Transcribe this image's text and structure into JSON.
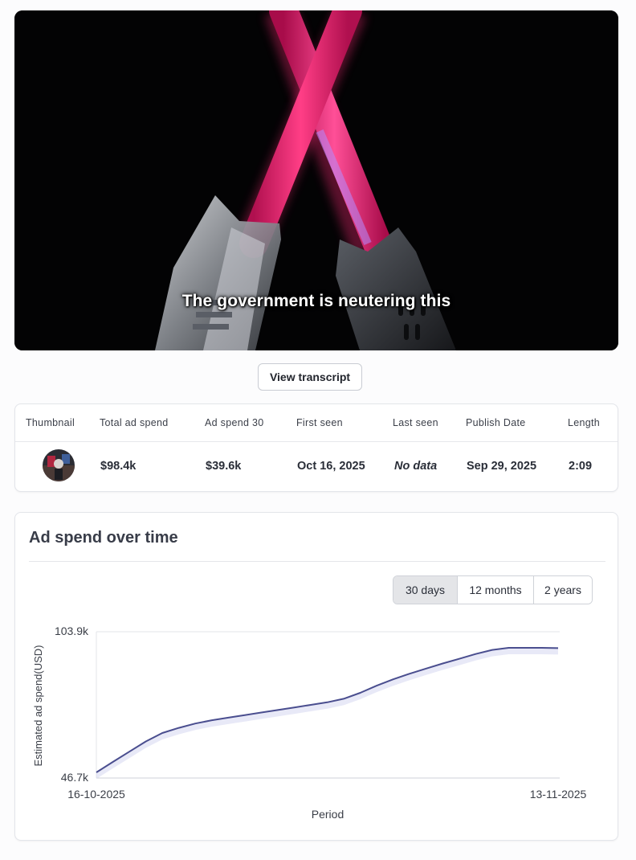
{
  "video": {
    "caption": "The government is neutering this"
  },
  "transcript_button": {
    "label": "View transcript"
  },
  "ad_table": {
    "headers": [
      "Thumbnail",
      "Total ad spend",
      "Ad spend 30",
      "First seen",
      "Last seen",
      "Publish Date",
      "Length"
    ],
    "row": {
      "total_ad_spend": "$98.4k",
      "ad_spend_30": "$39.6k",
      "first_seen": "Oct 16, 2025",
      "last_seen": "No data",
      "publish_date": "Sep 29, 2025",
      "length": "2:09"
    }
  },
  "chart_section": {
    "title": "Ad spend over time",
    "ranges": [
      "30 days",
      "12 months",
      "2 years"
    ],
    "active_range": "30 days"
  },
  "chart_data": {
    "type": "area",
    "title": "",
    "xlabel": "Period",
    "ylabel": "Estimated ad spend(USD)",
    "x_tick_labels": [
      "16-10-2025",
      "13-11-2025"
    ],
    "y_tick_labels": [
      "46.7k",
      "103.9k"
    ],
    "ylim": [
      46.7,
      103.9
    ],
    "y_unit": "k USD",
    "x": [
      "16-10-2025",
      "17-10-2025",
      "18-10-2025",
      "19-10-2025",
      "20-10-2025",
      "21-10-2025",
      "22-10-2025",
      "23-10-2025",
      "24-10-2025",
      "25-10-2025",
      "26-10-2025",
      "27-10-2025",
      "28-10-2025",
      "29-10-2025",
      "30-10-2025",
      "31-10-2025",
      "01-11-2025",
      "02-11-2025",
      "03-11-2025",
      "04-11-2025",
      "05-11-2025",
      "06-11-2025",
      "07-11-2025",
      "08-11-2025",
      "09-11-2025",
      "10-11-2025",
      "11-11-2025",
      "12-11-2025",
      "13-11-2025"
    ],
    "series": [
      {
        "values": [
          48.9,
          53.0,
          57.0,
          61.0,
          64.3,
          66.3,
          68.0,
          69.3,
          70.3,
          71.3,
          72.3,
          73.3,
          74.3,
          75.3,
          76.3,
          77.7,
          80.0,
          82.8,
          85.3,
          87.5,
          89.5,
          91.5,
          93.3,
          95.2,
          96.8,
          97.6,
          97.6,
          97.6,
          97.5
        ]
      }
    ],
    "line_color": "#4a4e8f",
    "fill_color": "#d6d7f0",
    "grid": false
  }
}
